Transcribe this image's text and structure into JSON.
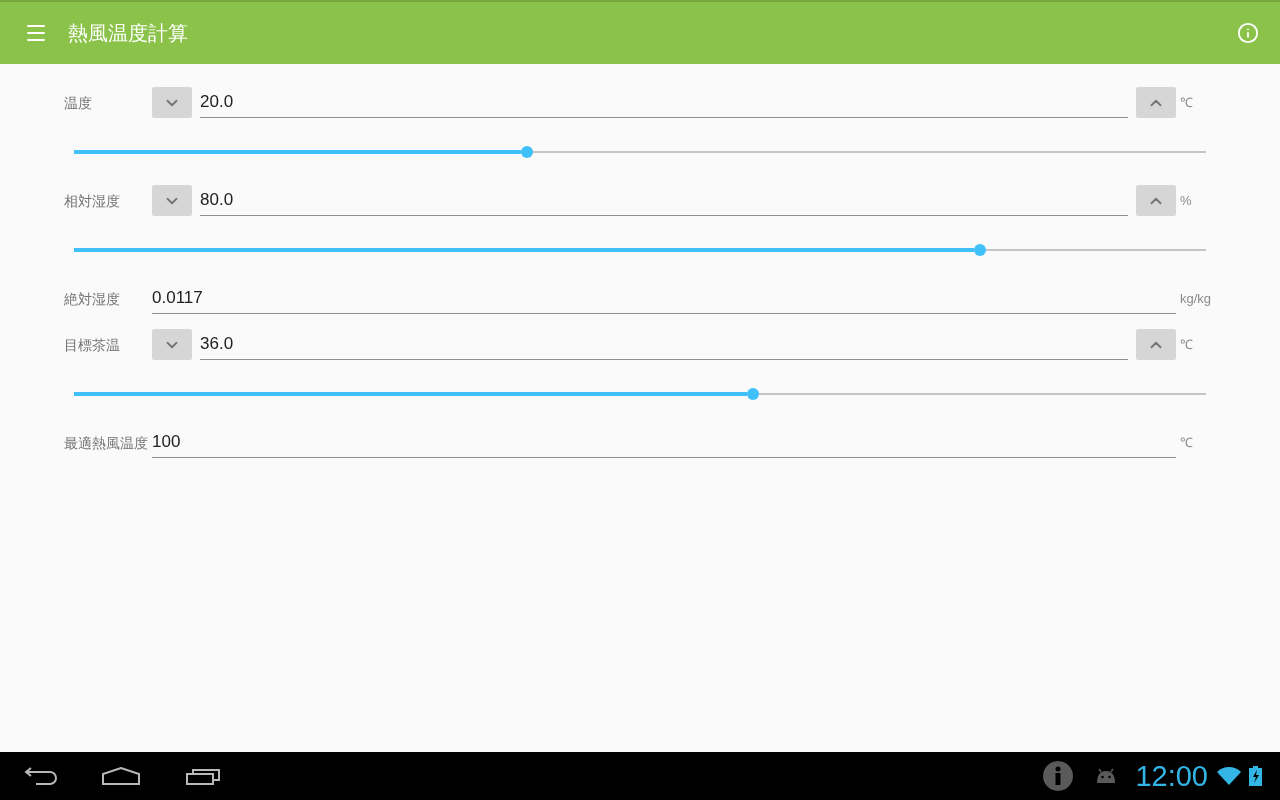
{
  "app_bar": {
    "title": "熱風温度計算"
  },
  "rows": [
    {
      "kind": "stepper",
      "label": "温度",
      "value": "20.0",
      "unit": "℃",
      "level": 0.4
    },
    {
      "kind": "stepper",
      "label": "相対湿度",
      "value": "80.0",
      "unit": "%",
      "level": 0.8
    },
    {
      "kind": "readout",
      "label": "絶対湿度",
      "value": "0.0117",
      "unit": "kg/kg"
    },
    {
      "kind": "stepper",
      "label": "目標茶温",
      "value": "36.0",
      "unit": "℃",
      "level": 0.6
    },
    {
      "kind": "readout",
      "label": "最適熱風温度",
      "value": "100",
      "unit": "℃"
    }
  ],
  "nav_bar": {
    "clock": "12:00"
  }
}
